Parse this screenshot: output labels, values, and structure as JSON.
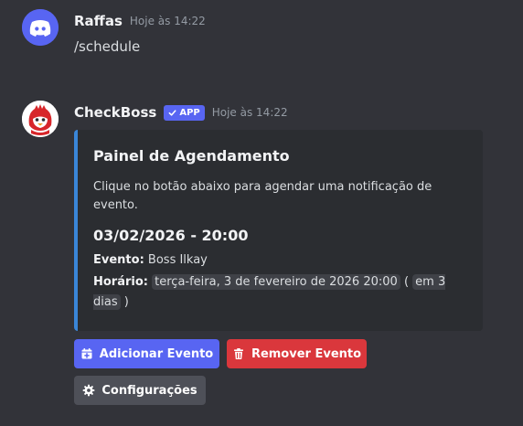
{
  "messages": [
    {
      "username": "Raffas",
      "timestamp": "Hoje às 14:22",
      "content": "/schedule",
      "avatar_icon": "discord-logo-icon",
      "avatar_color": "#5865f2"
    },
    {
      "username": "CheckBoss",
      "badge": "APP",
      "timestamp": "Hoje às 14:22",
      "avatar_icon": "red-mascot-icon",
      "avatar_color": "#d7262a"
    }
  ],
  "embed": {
    "accent_color": "#3a86d8",
    "title": "Painel de Agendamento",
    "description": "Clique no botão abaixo para agendar uma notificação de evento.",
    "subheading": "03/02/2026 - 20:00",
    "event_label": "Evento:",
    "event_value": "Boss Ilkay",
    "time_label": "Horário:",
    "time_value": "terça-feira, 3 de fevereiro de 2026 20:00",
    "relative_open": "(",
    "relative_value": "em 3 dias",
    "relative_close": ")"
  },
  "buttons": {
    "add": {
      "label": "Adicionar Evento",
      "icon": "calendar-plus-icon",
      "color": "#5865f2"
    },
    "remove": {
      "label": "Remover Evento",
      "icon": "trash-icon",
      "color": "#da373c"
    },
    "settings": {
      "label": "Configurações",
      "icon": "gear-icon",
      "color": "#4e5058"
    }
  }
}
